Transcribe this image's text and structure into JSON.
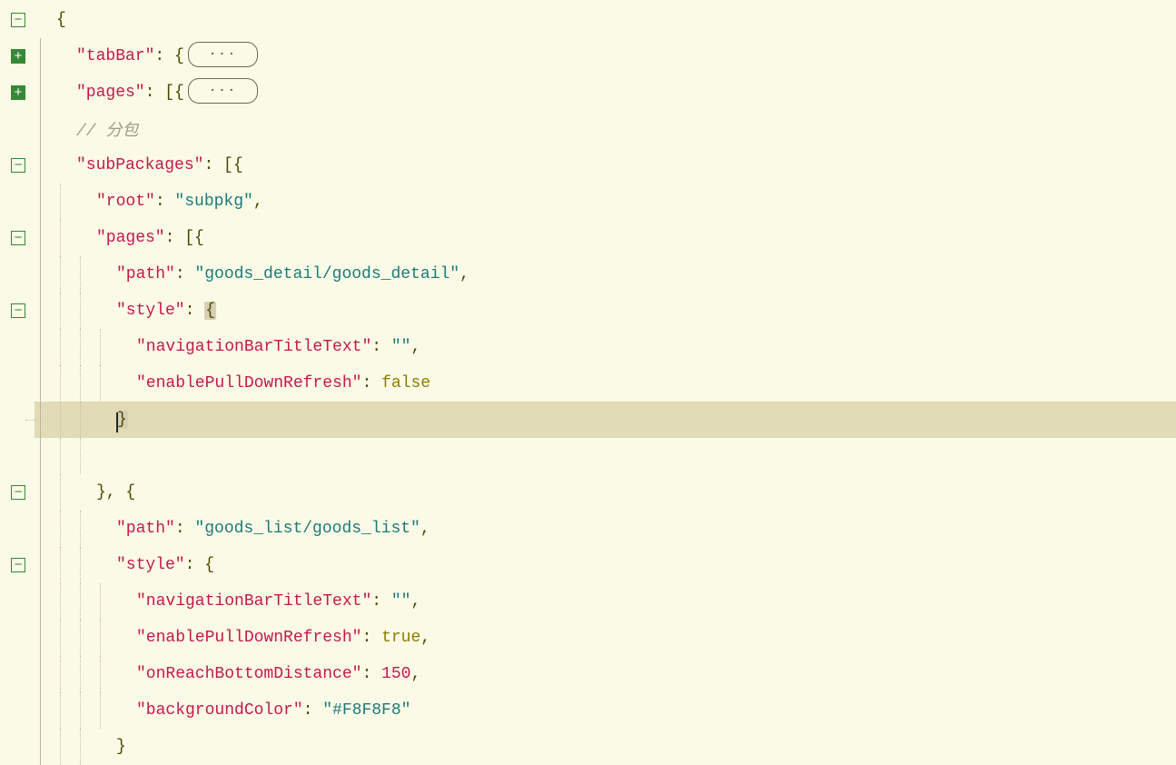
{
  "lines": {
    "l1": {
      "brace": "{"
    },
    "l2": {
      "key": "\"tabBar\"",
      "open": "{",
      "dots": "···"
    },
    "l3": {
      "key": "\"pages\"",
      "open": "[{",
      "dots": "···"
    },
    "l4": {
      "comment": "// 分包"
    },
    "l5": {
      "key": "\"subPackages\"",
      "open": "[{"
    },
    "l6": {
      "key": "\"root\"",
      "val": "\"subpkg\"",
      "comma": ","
    },
    "l7": {
      "key": "\"pages\"",
      "open": "[{"
    },
    "l8": {
      "key": "\"path\"",
      "val": "\"goods_detail/goods_detail\"",
      "comma": ","
    },
    "l9": {
      "key": "\"style\"",
      "open": "{"
    },
    "l10": {
      "key": "\"navigationBarTitleText\"",
      "val": "\"\"",
      "comma": ","
    },
    "l11": {
      "key": "\"enablePullDownRefresh\"",
      "bool": "false"
    },
    "l12": {
      "close": "}"
    },
    "l13": {},
    "l14": {
      "close": "}, {"
    },
    "l15": {
      "key": "\"path\"",
      "val": "\"goods_list/goods_list\"",
      "comma": ","
    },
    "l16": {
      "key": "\"style\"",
      "open": "{"
    },
    "l17": {
      "key": "\"navigationBarTitleText\"",
      "val": "\"\"",
      "comma": ","
    },
    "l18": {
      "key": "\"enablePullDownRefresh\"",
      "bool": "true",
      "comma": ","
    },
    "l19": {
      "key": "\"onReachBottomDistance\"",
      "num": "150",
      "comma": ","
    },
    "l20": {
      "key": "\"backgroundColor\"",
      "val": "\"#F8F8F8\""
    },
    "l21": {
      "close": "}"
    }
  }
}
